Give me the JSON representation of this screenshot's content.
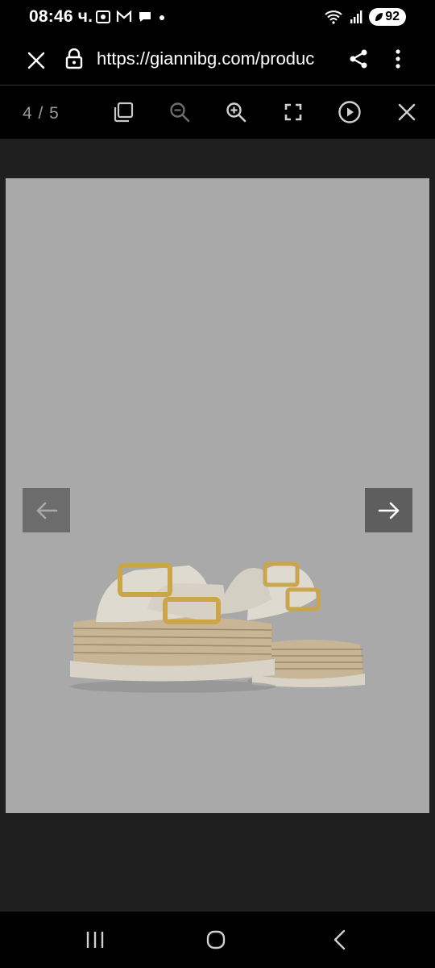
{
  "status": {
    "time": "08:46 ч.",
    "battery": "92"
  },
  "browser": {
    "url": "https://giannibg.com/produc"
  },
  "viewer": {
    "counter": "4 / 5"
  },
  "colors": {
    "toolbar_bg": "#000000",
    "photo_bg": "#a9a9a9",
    "viewer_bg": "#1f1f1f"
  }
}
